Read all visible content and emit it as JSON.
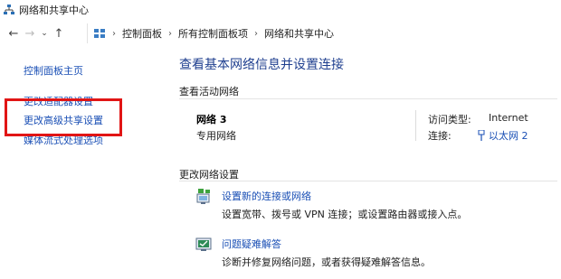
{
  "window": {
    "title": "网络和共享中心"
  },
  "address_bar": {
    "crumbs": [
      "控制面板",
      "所有控制面板项",
      "网络和共享中心"
    ]
  },
  "sidebar": {
    "items": [
      {
        "label": "控制面板主页"
      },
      {
        "label": "更改适配器设置"
      },
      {
        "label": "更改高级共享设置"
      },
      {
        "label": "媒体流式处理选项"
      }
    ]
  },
  "main": {
    "title": "查看基本网络信息并设置连接",
    "active_section": "查看活动网络",
    "network": {
      "name": "网络 3",
      "type": "专用网络",
      "access_type_label": "访问类型:",
      "access_type_value": "Internet",
      "connection_label": "连接:",
      "connection_value": "以太网 2"
    },
    "change_section": "更改网络设置",
    "tasks": [
      {
        "icon": "network-setup-icon",
        "link": "设置新的连接或网络",
        "desc": "设置宽带、拨号或 VPN 连接；或设置路由器或接入点。"
      },
      {
        "icon": "troubleshoot-icon",
        "link": "问题疑难解答",
        "desc": "诊断并修复网络问题，或者获得疑难解答信息。"
      }
    ]
  },
  "highlight_color": "#e11515"
}
